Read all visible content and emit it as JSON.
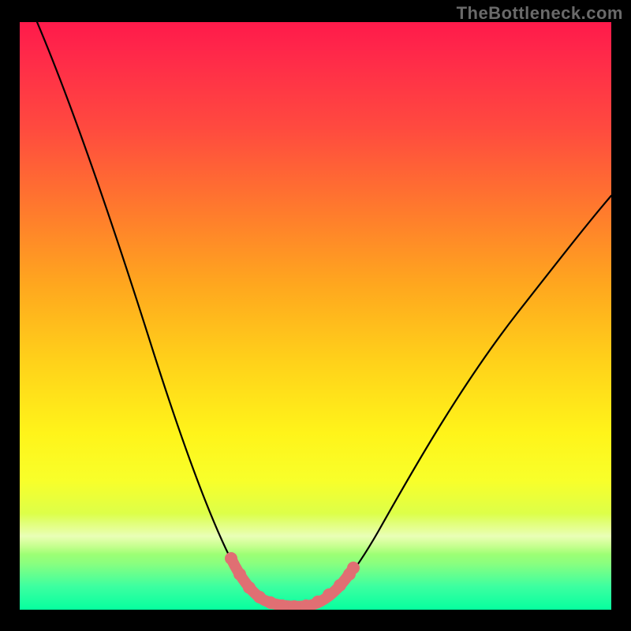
{
  "watermark": "TheBottleneck.com",
  "chart_data": {
    "type": "line",
    "title": "",
    "xlabel": "",
    "ylabel": "",
    "xlim": [
      0,
      100
    ],
    "ylim": [
      0,
      100
    ],
    "grid": false,
    "legend": false,
    "gradient_stops": [
      {
        "pct": 0,
        "color": "#ff1a4b"
      },
      {
        "pct": 6,
        "color": "#ff2a49"
      },
      {
        "pct": 18,
        "color": "#ff4a3f"
      },
      {
        "pct": 32,
        "color": "#ff7a2d"
      },
      {
        "pct": 45,
        "color": "#ffa81e"
      },
      {
        "pct": 58,
        "color": "#ffd21a"
      },
      {
        "pct": 70,
        "color": "#fff41a"
      },
      {
        "pct": 78,
        "color": "#f8ff2a"
      },
      {
        "pct": 86,
        "color": "#d2ff55"
      },
      {
        "pct": 92,
        "color": "#8cff7e"
      },
      {
        "pct": 96,
        "color": "#3dffa0"
      },
      {
        "pct": 100,
        "color": "#06ff9f"
      }
    ],
    "series": [
      {
        "name": "bottleneck-curve",
        "x": [
          3,
          9,
          15,
          21,
          27,
          32,
          36,
          39,
          41,
          43,
          45,
          48,
          51,
          55,
          60,
          67,
          75,
          84,
          93,
          100
        ],
        "y": [
          100,
          85,
          70,
          55,
          39,
          25,
          15,
          9,
          5,
          3,
          2,
          2,
          3,
          6,
          12,
          22,
          34,
          46,
          57,
          65
        ]
      },
      {
        "name": "highlight-segment",
        "x": [
          36,
          39,
          41,
          43,
          45,
          48,
          51,
          55
        ],
        "y": [
          15,
          9,
          5,
          3,
          2,
          2,
          3,
          6
        ],
        "color": "#e06f73"
      }
    ],
    "minimum": {
      "x": 46.5,
      "y": 2
    }
  }
}
